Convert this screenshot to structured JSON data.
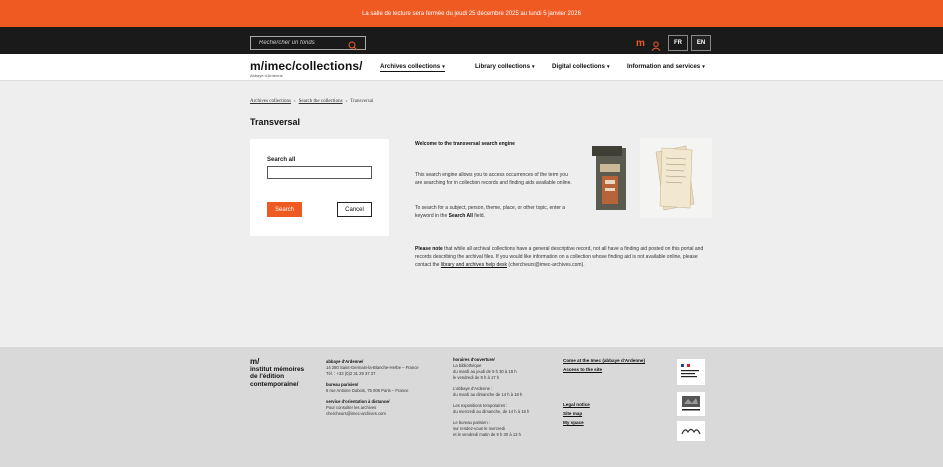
{
  "banner": {
    "text": "La salle de lecture sera fermée du jeudi 25 décembre 2025 au lundi 5 janvier 2026"
  },
  "topbar": {
    "search_placeholder": "Rechercher un fonds",
    "logo_mark": "m",
    "lang_fr": "FR",
    "lang_en": "EN"
  },
  "header": {
    "logo": "m/imec/collections/",
    "logo_sub": "Abbaye d'Ardenne",
    "nav": [
      {
        "label": "Archives collections"
      },
      {
        "label": "Library collections"
      },
      {
        "label": "Digital collections"
      },
      {
        "label": "Information and services"
      }
    ]
  },
  "breadcrumb": [
    "Archives collections",
    "Search the collections",
    "Transversal"
  ],
  "page_title": "Transversal",
  "search_form": {
    "label": "Search all",
    "search_button": "Search",
    "cancel_button": "Cancel"
  },
  "intro": {
    "title": "Welcome to the transversal search engine",
    "p1": "This search engine allows you to access occurrences of the term you are searching for in collection records and finding aids available online.",
    "p2_pre": "To search for a subject, person, theme, place, or other topic, enter a keyword in the ",
    "p2_bold": "Search All",
    "p2_post": " field."
  },
  "note": {
    "bold": "Please note",
    "text": " that while all archival collections have a general descriptive record, not all have a finding aid posted on this portal and records describing the archival files. If you would like information on a collection whose finding aid is not available online, please contact the ",
    "link": "library and archives help desk",
    "email": " (chercheurs@imec-archives.com)."
  },
  "footer": {
    "brand_mark": "m/",
    "brand": [
      "institut mémoires",
      "de l'édition",
      "contemporaine/"
    ],
    "col1": {
      "h1": "abbaye d'Ardenne/",
      "l1": "14 280 Saint-Germain-la-Blanche-Herbe – France",
      "l2": "Tél. : +33 (0)2 31 29 37 37",
      "h2": "bureau parisien/",
      "l3": "6 rue Antoine Dubois, 75 006 Paris – France",
      "h3": "service d'orientation à distance/",
      "l4": "Pour consulter les archives",
      "l5": "chercheurs@imec-archives.com"
    },
    "col2": {
      "h": "horaires d'ouverture/",
      "lines1": [
        "La bibliothèque",
        "du mardi au jeudi de 9 h 30 à 18 h",
        "le vendredi de 9 h à 17 h"
      ],
      "lines2": [
        "L'abbaye d'Ardenne :",
        "du mardi au dimanche de 14 h à 18 h"
      ],
      "lines3": [
        "Les expositions temporaires :",
        "du mercredi au dimanche, de 14 h à 18 h"
      ],
      "lines4": [
        "Le bureau parisien :",
        "sur rendez-vous le mercredi",
        "et le vendredi matin de 9 h 30 à 13 h"
      ]
    },
    "links": [
      "Come at the Imec (abbaye d'Ardenne)",
      "Access to the site",
      "Legal notice",
      "Site map",
      "My space"
    ],
    "partner_logos": [
      "prefet-region-normandie",
      "region-normandie",
      "caen-la-mer"
    ]
  },
  "colors": {
    "accent": "#ef5a23",
    "topbar": "#1a1a1a",
    "footer": "#d9d9d9"
  }
}
